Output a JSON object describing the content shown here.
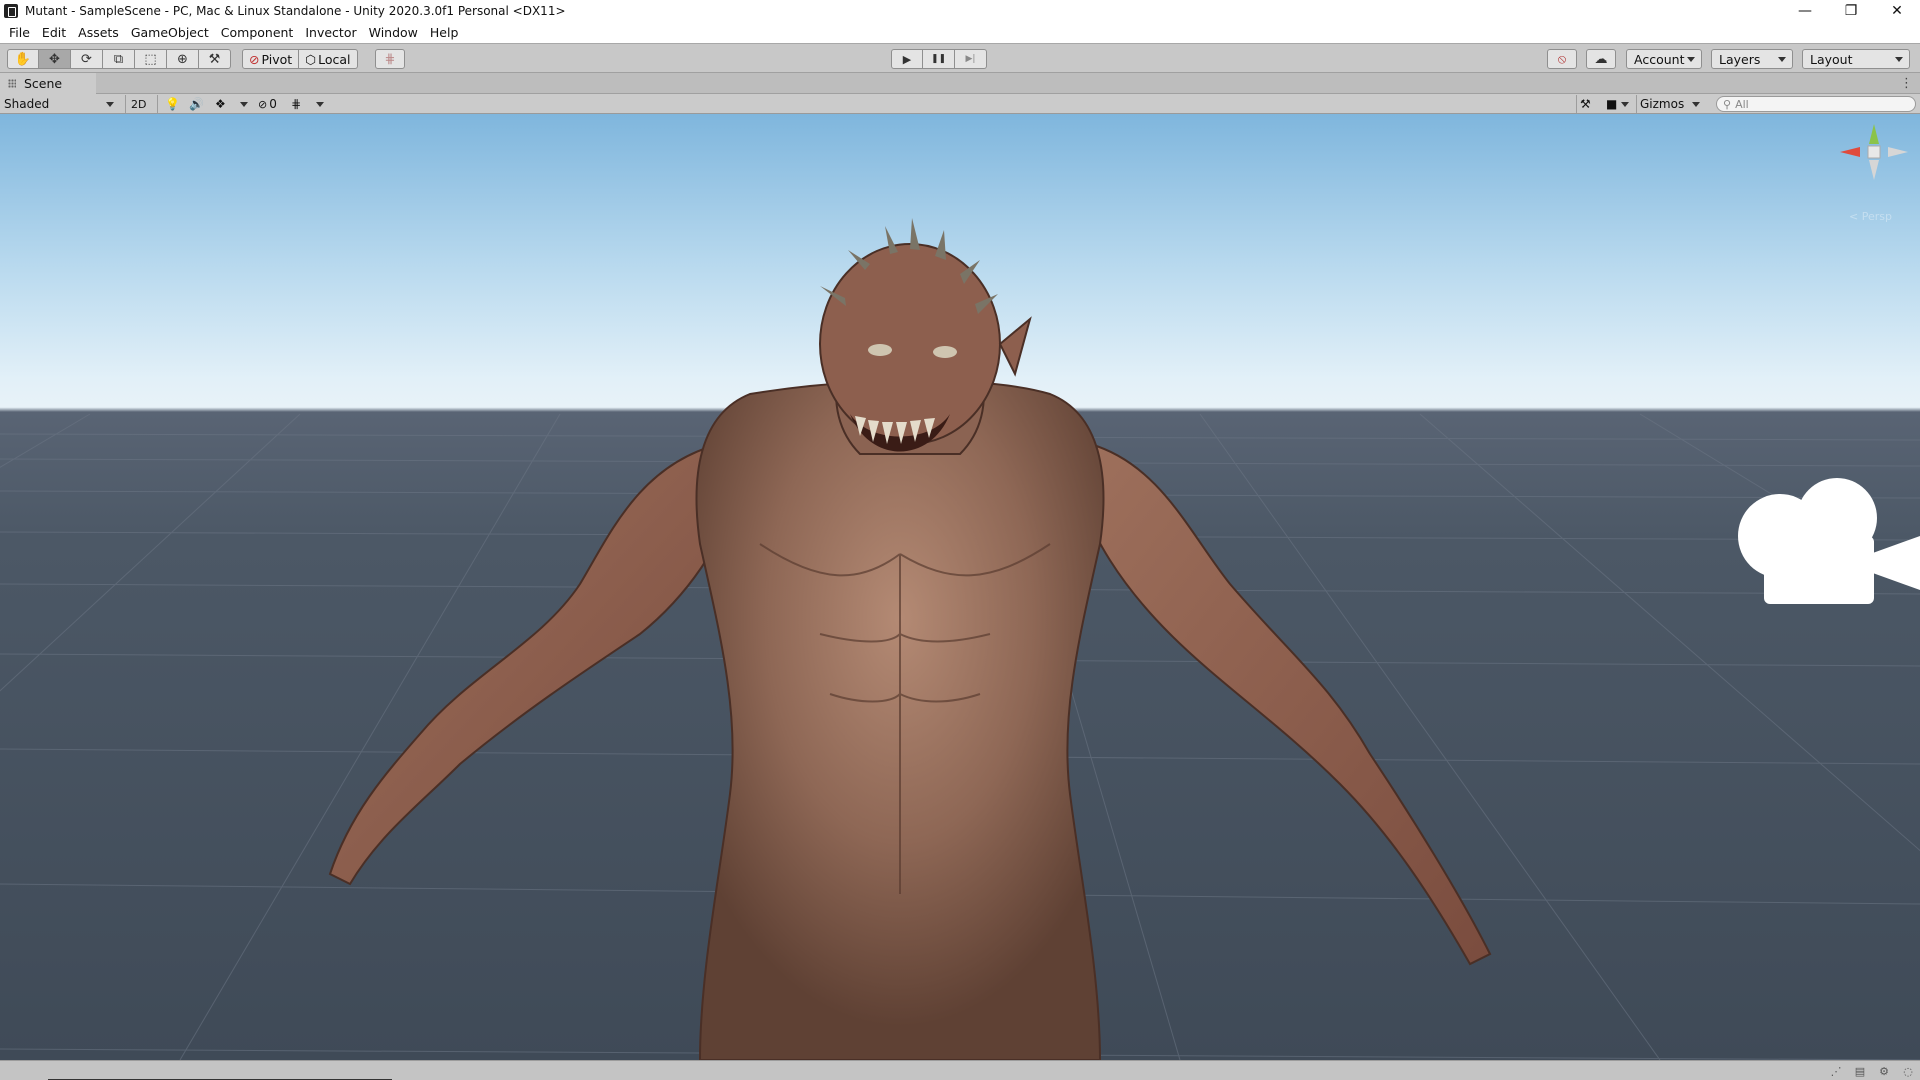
{
  "window": {
    "title": "Mutant - SampleScene - PC, Mac & Linux Standalone - Unity 2020.3.0f1 Personal <DX11>",
    "minimize": "—",
    "restore": "❐",
    "close": "✕"
  },
  "menu": [
    "File",
    "Edit",
    "Assets",
    "GameObject",
    "Component",
    "Invector",
    "Window",
    "Help"
  ],
  "toolbar": {
    "tools": [
      {
        "name": "hand-tool",
        "glyph": "✋"
      },
      {
        "name": "move-tool",
        "glyph": "✥"
      },
      {
        "name": "rotate-tool",
        "glyph": "⟳"
      },
      {
        "name": "scale-tool",
        "glyph": "⧉"
      },
      {
        "name": "rect-tool",
        "glyph": "⬚"
      },
      {
        "name": "transform-tool",
        "glyph": "⊕"
      },
      {
        "name": "custom-tool",
        "glyph": "⚒"
      }
    ],
    "active_tool": "move-tool",
    "pivot_label": "Pivot",
    "local_label": "Local",
    "play_glyph": "▶",
    "pause_glyph": "❚❚",
    "step_glyph": "▶|",
    "account_label": "Account",
    "layers_label": "Layers",
    "layout_label": "Layout"
  },
  "scene": {
    "tab_label": "Scene",
    "shading_mode": "Shaded",
    "mode_2d": "2D",
    "hidden_count": "0",
    "gizmos_label": "Gizmos",
    "search_placeholder": "All",
    "projection_label": "< Persp"
  },
  "colors": {
    "sky_top": "#7fb6dd",
    "horizon": "#e8f2f8",
    "ground": "#4c5866",
    "skin": "#9a6f5c"
  }
}
